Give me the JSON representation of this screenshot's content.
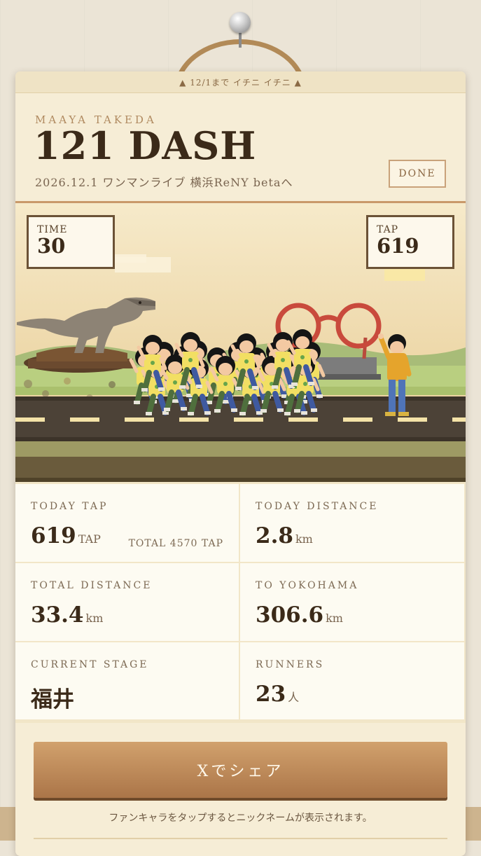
{
  "banner": "▲ 12/1まで イチニ イチニ ▲",
  "header": {
    "subtitle": "MAAYA TAKEDA",
    "title": "121 DASH",
    "caption": "2026.12.1 ワンマンライブ 横浜ReNY betaへ",
    "done_label": "DONE"
  },
  "hud": {
    "time_label": "TIME",
    "time_value": "30",
    "tap_label": "TAP",
    "tap_value": "619"
  },
  "stats": {
    "today_tap": {
      "label": "TODAY TAP",
      "value": "619",
      "unit": "TAP",
      "total": "TOTAL 4570 TAP"
    },
    "today_distance": {
      "label": "TODAY DISTANCE",
      "value": "2.8",
      "unit": "km"
    },
    "total_distance": {
      "label": "TOTAL DISTANCE",
      "value": "33.4",
      "unit": "km"
    },
    "to_yokohama": {
      "label": "TO YOKOHAMA",
      "value": "306.6",
      "unit": "km"
    },
    "current_stage": {
      "label": "CURRENT STAGE",
      "value": "福井"
    },
    "runners": {
      "label": "RUNNERS",
      "value": "23",
      "unit": "人"
    }
  },
  "share_label": "Xでシェア",
  "hint": "ファンキャラをタップするとニックネームが表示されます。",
  "colors": {
    "accent": "#c9996a",
    "button": "#b98150",
    "text": "#3b2a19",
    "sky": "#f3e2ba",
    "road": "#4c4237"
  },
  "icons": [
    "pushpin-icon",
    "dinosaur-statue-icon",
    "glasses-monument-icon"
  ]
}
